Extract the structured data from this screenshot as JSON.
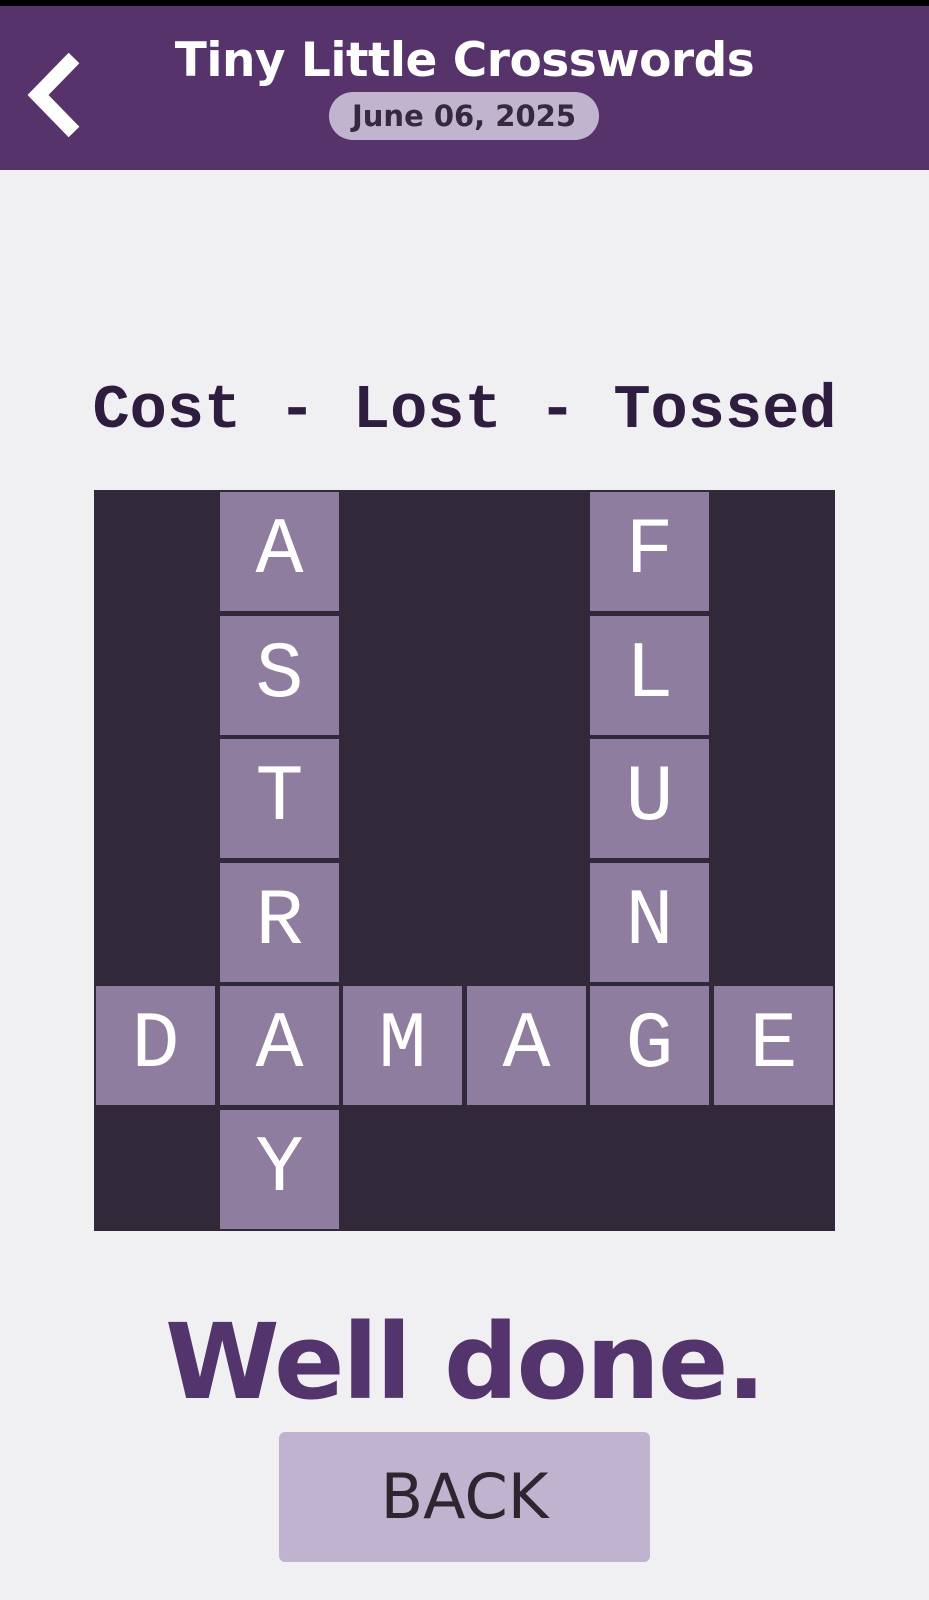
{
  "header": {
    "title": "Tiny Little Crosswords",
    "date": "June 06, 2025",
    "back_icon": "chevron-left-icon"
  },
  "puzzle": {
    "clue": "Cost - Lost - Tossed",
    "rows": 6,
    "cols": 6,
    "cells": [
      {
        "row": 0,
        "col": 1,
        "letter": "A"
      },
      {
        "row": 1,
        "col": 1,
        "letter": "S"
      },
      {
        "row": 2,
        "col": 1,
        "letter": "T"
      },
      {
        "row": 3,
        "col": 1,
        "letter": "R"
      },
      {
        "row": 4,
        "col": 1,
        "letter": "A"
      },
      {
        "row": 5,
        "col": 1,
        "letter": "Y"
      },
      {
        "row": 0,
        "col": 4,
        "letter": "F"
      },
      {
        "row": 1,
        "col": 4,
        "letter": "L"
      },
      {
        "row": 2,
        "col": 4,
        "letter": "U"
      },
      {
        "row": 3,
        "col": 4,
        "letter": "N"
      },
      {
        "row": 4,
        "col": 4,
        "letter": "G"
      },
      {
        "row": 4,
        "col": 0,
        "letter": "D"
      },
      {
        "row": 4,
        "col": 2,
        "letter": "M"
      },
      {
        "row": 4,
        "col": 3,
        "letter": "A"
      },
      {
        "row": 4,
        "col": 5,
        "letter": "E"
      }
    ],
    "colors": {
      "board": "#312839",
      "cell": "#8e7d9e",
      "letter": "#ffffff"
    }
  },
  "result": {
    "message": "Well done.",
    "back_label": "BACK"
  },
  "colors": {
    "header_bg": "#56346b",
    "accent": "#54346c",
    "button_bg": "#c0b3cf",
    "page_bg": "#f0f0f3"
  }
}
